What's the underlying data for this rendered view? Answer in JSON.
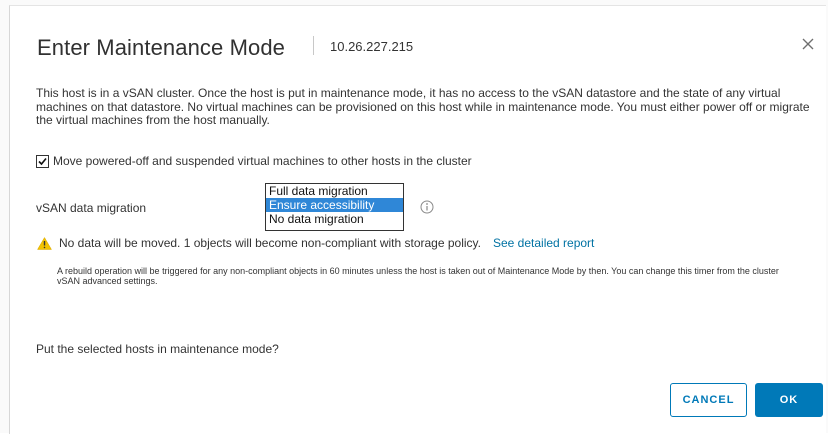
{
  "dialog": {
    "title": "Enter Maintenance Mode",
    "host": "10.26.227.215",
    "close_icon": "close-icon",
    "description": "This host is in a vSAN cluster. Once the host is put in maintenance mode, it has no access to the vSAN datastore and the state of any virtual machines on that datastore. No virtual machines can be provisioned on this host while in maintenance mode. You must either power off or migrate the virtual machines from the host manually.",
    "move_checkbox": {
      "label": "Move powered-off and suspended virtual machines to other hosts in the cluster",
      "checked": true
    },
    "vsan_migration": {
      "label": "vSAN data migration",
      "options": [
        "Full data migration",
        "Ensure accessibility",
        "No data migration"
      ],
      "selected": "Ensure accessibility",
      "info_icon": "info-icon"
    },
    "warning": {
      "icon": "warning-icon",
      "text": "No data will be moved. 1 objects will become non-compliant with storage policy.",
      "link": "See detailed report"
    },
    "note": "A rebuild operation will be triggered for any non-compliant objects in 60 minutes unless the host is taken out of Maintenance Mode by then. You can change this timer from the cluster vSAN advanced settings.",
    "question": "Put the selected hosts in maintenance mode?",
    "buttons": {
      "cancel": "CANCEL",
      "ok": "OK"
    }
  },
  "colors": {
    "accent": "#0079b8",
    "selection": "#2f87d7",
    "warning": "#f2c200"
  }
}
